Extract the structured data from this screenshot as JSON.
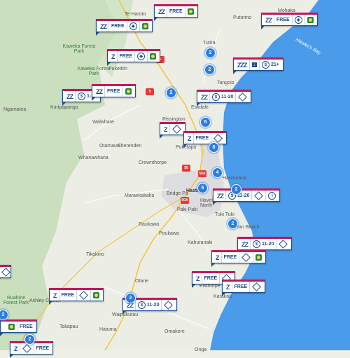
{
  "places": [
    "Te Haroto",
    "Putorino",
    "Mohaka",
    "Kaweka Forest Park",
    "Kaweka Forest Park",
    "Puketitiri",
    "Tutira",
    "Hawke's Bay",
    "Tangoio",
    "Eskdale",
    "Ngamatea",
    "Kuripapango",
    "Walwhare",
    "Rissington",
    "Otamauri",
    "Sherenden",
    "Puketapu",
    "Whanawhana",
    "Crownthorpe",
    "Haumoana",
    "Maraekakaho",
    "Bridge Pa",
    "Hastings",
    "Havelock North",
    "Paki Paki",
    "Tuki Tuki",
    "Ocean Beach",
    "Raukawa",
    "Poukawa",
    "Kahuranaki",
    "Tikokino",
    "Otane",
    "Elsthorpe",
    "Karakau",
    "Ruahine Forest Park",
    "Ashley Clinton",
    "Waipukurau",
    "Takapau",
    "Hatuma",
    "Omakere",
    "Onga"
  ],
  "road_badges": [
    "5",
    "5",
    "50",
    "50A",
    "50A"
  ],
  "cards": [
    {
      "sleep": "ZZ",
      "label": "FREE",
      "icons": [
        "toilet-icon",
        "campsite-icon"
      ]
    },
    {
      "sleep": "ZZ",
      "label": "FREE",
      "icons": [
        "toilet-icon",
        "campsite-icon"
      ]
    },
    {
      "sleep": "ZZ",
      "label": "FREE",
      "icons": [
        "toilet-icon",
        "campsite-icon"
      ]
    },
    {
      "sleep": "Z",
      "label": "FREE",
      "icons": [
        "toilet-icon",
        "campsite-icon"
      ]
    },
    {
      "sleep": "ZZZ",
      "label": "21+",
      "icons": [
        "download-icon",
        "money-icon"
      ]
    },
    {
      "sleep": "ZZ",
      "label": "1-10",
      "icons": [
        "money-icon"
      ]
    },
    {
      "sleep": "ZZ",
      "label": "FREE",
      "icons": [
        "campsite-icon"
      ]
    },
    {
      "sleep": "ZZ",
      "label": "11-20",
      "icons": [
        "money-icon",
        "toilet-icon"
      ]
    },
    {
      "sleep": "Z",
      "label": "",
      "icons": [
        "toilet-icon"
      ]
    },
    {
      "sleep": "Z",
      "label": "FREE",
      "icons": [
        "toilet-icon"
      ]
    },
    {
      "sleep": "ZZ",
      "label": "11-20",
      "icons": [
        "money-icon",
        "toilet-icon",
        "info-icon"
      ]
    },
    {
      "sleep": "ZZ",
      "label": "11-20",
      "icons": [
        "money-icon",
        "toilet-icon"
      ]
    },
    {
      "sleep": "Z",
      "label": "FREE",
      "icons": [
        "toilet-icon",
        "campsite-icon"
      ]
    },
    {
      "sleep": "Z",
      "label": "FREE",
      "icons": [
        "toilet-icon"
      ]
    },
    {
      "sleep": "Z",
      "label": "FREE",
      "icons": [
        "toilet-icon"
      ]
    },
    {
      "sleep": "Z",
      "label": "FREE",
      "icons": [
        "toilet-icon",
        "campsite-icon"
      ]
    },
    {
      "sleep": "ZZ",
      "label": "11-20",
      "icons": [
        "money-icon",
        "toilet-icon"
      ]
    },
    {
      "sleep": "",
      "label": "FREE",
      "icons": [
        "campsite-icon"
      ]
    },
    {
      "sleep": "Z",
      "label": "FREE",
      "icons": [
        "toilet-icon"
      ]
    }
  ],
  "clusters": [
    "2",
    "2",
    "2",
    "5",
    "8",
    "4",
    "5",
    "2",
    "2",
    "2",
    "2",
    "2"
  ]
}
